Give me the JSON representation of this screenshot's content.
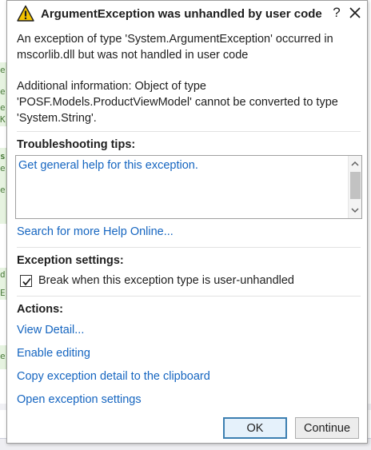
{
  "dialog": {
    "title": "ArgumentException was unhandled by user code",
    "help_glyph": "?",
    "message_line1": "An exception of type 'System.ArgumentException' occurred in",
    "message_line2": "mscorlib.dll but was not handled in user code",
    "additional_line1": "Additional information: Object of type",
    "additional_line2": "'POSF.Models.ProductViewModel' cannot be converted to type",
    "additional_line3": "'System.String'."
  },
  "troubleshooting": {
    "heading": "Troubleshooting tips:",
    "tip_link": "Get general help for this exception.",
    "search_link": "Search for more Help Online..."
  },
  "exception_settings": {
    "heading": "Exception settings:",
    "checkbox_label": "Break when this exception type is user-unhandled",
    "checkbox_checked": true
  },
  "actions": {
    "heading": "Actions:",
    "items": [
      "View Detail...",
      "Enable editing",
      "Copy exception detail to the clipboard",
      "Open exception settings"
    ]
  },
  "buttons": {
    "ok": "OK",
    "continue": "Continue"
  },
  "background": {
    "glyphs": [
      "e",
      "e",
      "e",
      "K",
      "s",
      "e",
      "e",
      "d.",
      "E",
      "e"
    ]
  },
  "colors": {
    "link": "#1565c0",
    "warning": "#f5c400",
    "code_highlight": "#e6f3e0"
  }
}
